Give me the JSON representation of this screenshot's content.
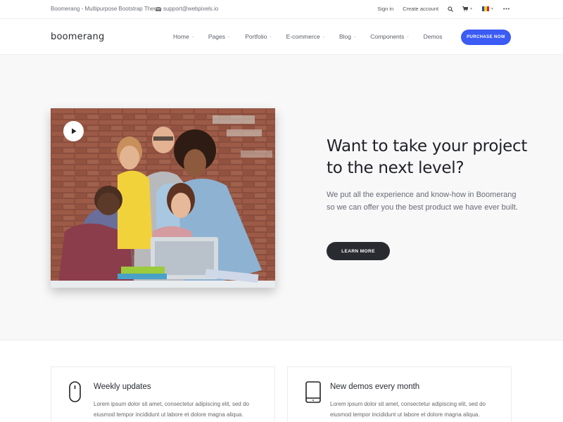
{
  "topbar": {
    "tagline": "Boomerang - Multipurpose Bootstrap Theme",
    "email": "support@webpixels.io",
    "sign_in": "Sign in",
    "create_account": "Create account",
    "icons": [
      "mail-icon",
      "search-icon",
      "cart-icon",
      "flag-icon",
      "more-icon"
    ]
  },
  "navbar": {
    "logo": "boomerang",
    "items": [
      {
        "label": "Home",
        "has_dropdown": true
      },
      {
        "label": "Pages",
        "has_dropdown": true
      },
      {
        "label": "Portfolio",
        "has_dropdown": true
      },
      {
        "label": "E-commerce",
        "has_dropdown": true
      },
      {
        "label": "Blog",
        "has_dropdown": true
      },
      {
        "label": "Components",
        "has_dropdown": true
      },
      {
        "label": "Demos",
        "has_dropdown": false
      }
    ],
    "cta": "PURCHASE NOW",
    "accent_color": "#3b5bf4"
  },
  "hero": {
    "heading": "Want to take your project to the next level?",
    "body": "We put all the experience and know-how in Boomerang so we can offer you the best product we have ever built.",
    "button": "LEARN MORE",
    "media": {
      "icon": "play-icon",
      "image": "team-photo"
    }
  },
  "features": [
    {
      "icon": "mouse-icon",
      "title": "Weekly updates",
      "text": "Lorem ipsum dolor sit amet, consectetur adipiscing elit, sed do eiusmod tempor incididunt ut labore et dolore magna aliqua. Quisque congue augue rutrum neque iaculis porta."
    },
    {
      "icon": "tablet-icon",
      "title": "New demos every month",
      "text": "Lorem ipsum dolor sit amet, consectetur adipiscing elit, sed do eiusmod tempor incididunt ut labore et dolore magna aliqua. Quisque congue augue rutrum neque iaculis porta."
    }
  ]
}
